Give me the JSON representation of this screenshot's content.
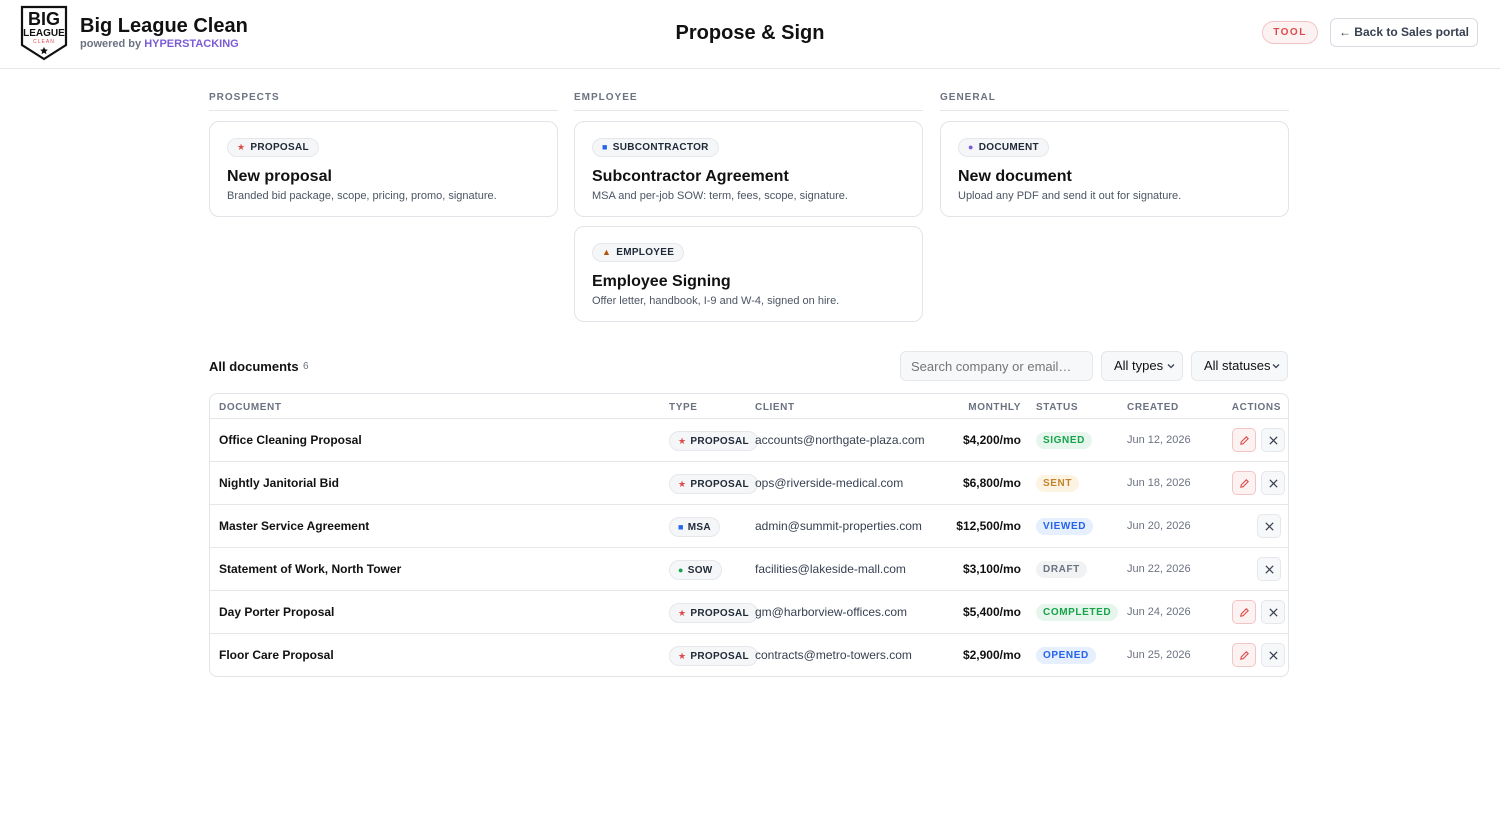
{
  "colors": {
    "accent_purple": "#7c5cd6",
    "tool_red": "#dc4b4b",
    "signed": "#16a34a",
    "sent": "#c2852d",
    "viewed": "#2563eb",
    "draft": "#6b7280",
    "completed": "#16a34a",
    "opened": "#2563eb"
  },
  "header": {
    "logo_lines": [
      "BIG",
      "LEAGUE",
      "CLEAN"
    ],
    "brand_title": "Big League Clean",
    "brand_sub_prefix": "powered by",
    "brand_sub_accent": "HYPERSTACKING",
    "page_title": "Propose & Sign",
    "tool_badge": "TOOL",
    "back_button": "← Back to Sales portal"
  },
  "sections": [
    {
      "label": "PROSPECTS",
      "cards": [
        {
          "pill_icon": "star-icon",
          "pill_glyph": "★",
          "pill_color": "#dc4b4b",
          "pill": "PROPOSAL",
          "title": "New proposal",
          "description": "Branded bid package, scope, pricing, promo, signature."
        }
      ]
    },
    {
      "label": "EMPLOYEE",
      "cards": [
        {
          "pill_icon": "square-icon",
          "pill_glyph": "■",
          "pill_color": "#2563eb",
          "pill": "SUBCONTRACTOR",
          "title": "Subcontractor Agreement",
          "description": "MSA and per-job SOW: term, fees, scope, signature."
        },
        {
          "pill_icon": "triangle-icon",
          "pill_glyph": "▲",
          "pill_color": "#b45309",
          "pill": "EMPLOYEE",
          "title": "Employee Signing",
          "description": "Offer letter, handbook, I-9 and W-4, signed on hire."
        }
      ]
    },
    {
      "label": "GENERAL",
      "cards": [
        {
          "pill_icon": "dot-icon",
          "pill_glyph": "●",
          "pill_color": "#7c5cd6",
          "pill": "DOCUMENT",
          "title": "New document",
          "description": "Upload any PDF and send it out for signature."
        }
      ]
    }
  ],
  "documents": {
    "title": "All documents",
    "count": "6",
    "search_placeholder": "Search company or email…",
    "type_filter": "All types",
    "status_filter": "All statuses",
    "columns": [
      "DOCUMENT",
      "TYPE",
      "CLIENT",
      "MONTHLY",
      "STATUS",
      "CREATED",
      "ACTIONS"
    ],
    "rows": [
      {
        "name": "Office Cleaning Proposal",
        "type_icon": "star-icon",
        "type_glyph": "★",
        "type_color": "#dc4b4b",
        "type": "PROPOSAL",
        "client": "accounts@northgate-plaza.com",
        "monthly": "$4,200/mo",
        "status": "SIGNED",
        "status_fg": "#16a34a",
        "status_bg": "#e7f6ec",
        "created": "Jun 12, 2026",
        "editable": true
      },
      {
        "name": "Nightly Janitorial Bid",
        "type_icon": "star-icon",
        "type_glyph": "★",
        "type_color": "#dc4b4b",
        "type": "PROPOSAL",
        "client": "ops@riverside-medical.com",
        "monthly": "$6,800/mo",
        "status": "SENT",
        "status_fg": "#c2852d",
        "status_bg": "#fdf3e3",
        "created": "Jun 18, 2026",
        "editable": true
      },
      {
        "name": "Master Service Agreement",
        "type_icon": "square-icon",
        "type_glyph": "■",
        "type_color": "#2563eb",
        "type": "MSA",
        "client": "admin@summit-properties.com",
        "monthly": "$12,500/mo",
        "status": "VIEWED",
        "status_fg": "#2563eb",
        "status_bg": "#e6effd",
        "created": "Jun 20, 2026",
        "editable": false
      },
      {
        "name": "Statement of Work, North Tower",
        "type_icon": "dot-icon",
        "type_glyph": "●",
        "type_color": "#16a34a",
        "type": "SOW",
        "client": "facilities@lakeside-mall.com",
        "monthly": "$3,100/mo",
        "status": "DRAFT",
        "status_fg": "#6b7280",
        "status_bg": "#f1f2f4",
        "created": "Jun 22, 2026",
        "editable": false
      },
      {
        "name": "Day Porter Proposal",
        "type_icon": "star-icon",
        "type_glyph": "★",
        "type_color": "#dc4b4b",
        "type": "PROPOSAL",
        "client": "gm@harborview-offices.com",
        "monthly": "$5,400/mo",
        "status": "COMPLETED",
        "status_fg": "#16a34a",
        "status_bg": "#e7f6ec",
        "created": "Jun 24, 2026",
        "editable": true
      },
      {
        "name": "Floor Care Proposal",
        "type_icon": "star-icon",
        "type_glyph": "★",
        "type_color": "#dc4b4b",
        "type": "PROPOSAL",
        "client": "contracts@metro-towers.com",
        "monthly": "$2,900/mo",
        "status": "OPENED",
        "status_fg": "#2563eb",
        "status_bg": "#e6effd",
        "created": "Jun 25, 2026",
        "editable": true
      }
    ]
  }
}
